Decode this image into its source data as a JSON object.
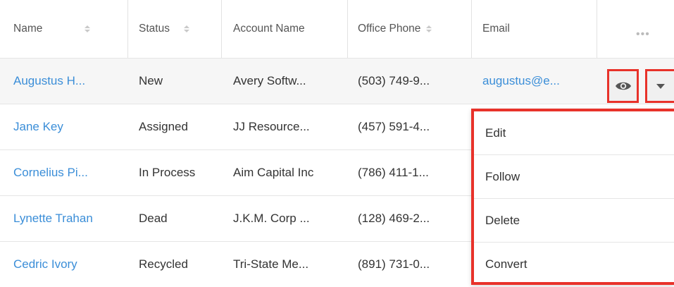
{
  "columns": [
    {
      "label": "Name",
      "sortable": true
    },
    {
      "label": "Status",
      "sortable": true
    },
    {
      "label": "Account Name",
      "sortable": false
    },
    {
      "label": "Office Phone",
      "sortable": true
    },
    {
      "label": "Email",
      "sortable": false
    }
  ],
  "more_columns_label": "•••",
  "rows": [
    {
      "name": "Augustus H...",
      "status": "New",
      "account": "Avery Softw...",
      "phone": "(503) 749-9...",
      "email": "augustus@e..."
    },
    {
      "name": "Jane Key",
      "status": "Assigned",
      "account": "JJ Resource...",
      "phone": "(457) 591-4...",
      "email": ""
    },
    {
      "name": "Cornelius Pi...",
      "status": "In Process",
      "account": "Aim Capital Inc",
      "phone": "(786) 411-1...",
      "email": ""
    },
    {
      "name": "Lynette Trahan",
      "status": "Dead",
      "account": "J.K.M. Corp ...",
      "phone": "(128) 469-2...",
      "email": ""
    },
    {
      "name": "Cedric Ivory",
      "status": "Recycled",
      "account": "Tri-State Me...",
      "phone": "(891) 731-0...",
      "email": ""
    }
  ],
  "row_actions": {
    "preview_icon": "eye-icon",
    "dropdown_icon": "caret-down-icon",
    "menu_items": [
      "Edit",
      "Follow",
      "Delete",
      "Convert"
    ]
  },
  "colors": {
    "link": "#3b8ed8",
    "highlight": "#e8322a"
  }
}
